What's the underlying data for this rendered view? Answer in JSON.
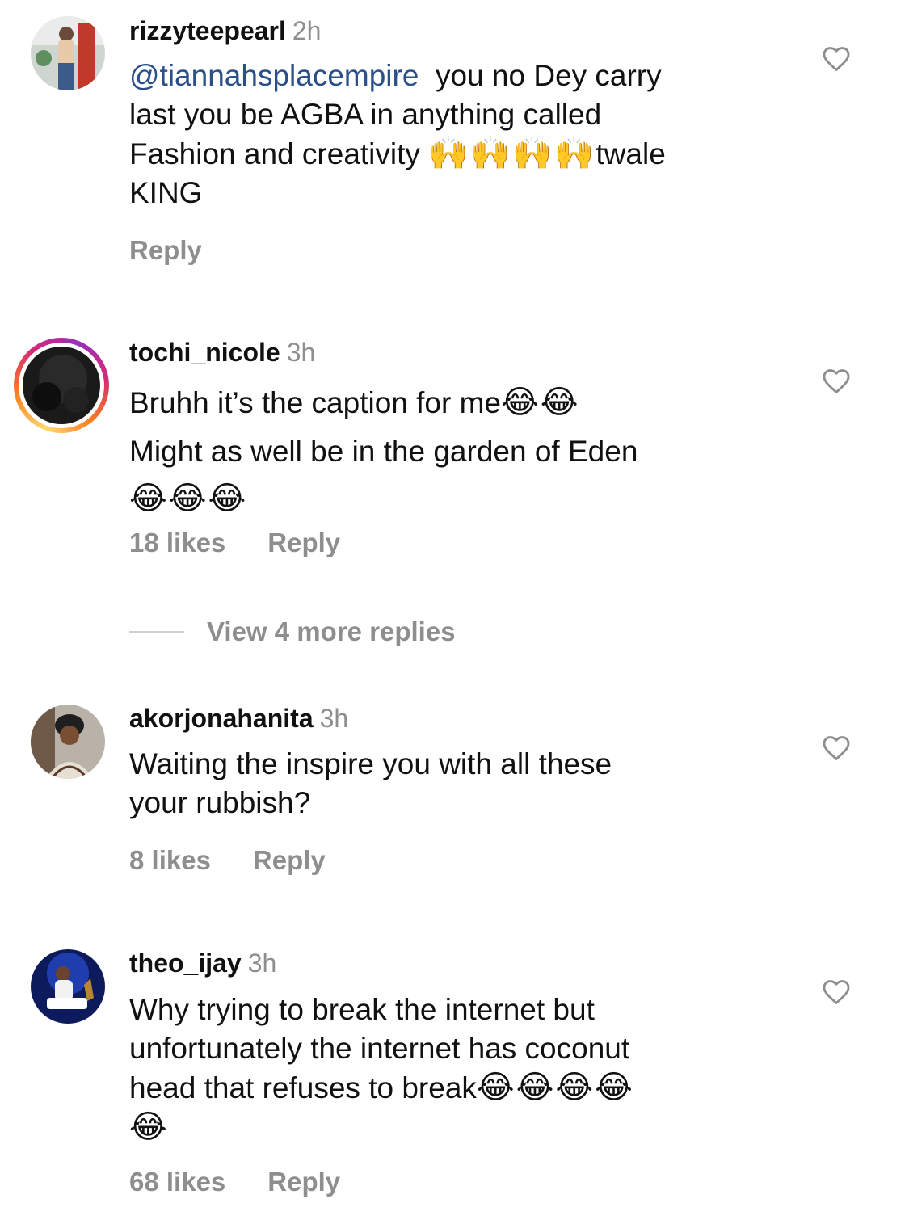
{
  "comments": [
    {
      "username": "rizzyteepearl",
      "time": "2h",
      "mention": "@tiannahsplacempire",
      "text_lines": [
        "  you no Dey carry",
        "last you be AGBA in anything called",
        "Fashion and creativity ",
        "KING"
      ],
      "emoji_inline": "🙌🙌🙌🙌",
      "text_after_emoji": "twale",
      "likes": "",
      "reply": "Reply"
    },
    {
      "username": "tochi_nicole",
      "time": "3h",
      "text_lines": [
        "Bruhh it’s the caption for me",
        "Might as well be in the garden of Eden"
      ],
      "emoji_line1": "😂😂",
      "emoji_line3": "😂😂😂",
      "likes": "18 likes",
      "reply": "Reply",
      "view_more": "View 4 more replies"
    },
    {
      "username": "akorjonahanita",
      "time": "3h",
      "text_lines": [
        "Waiting the inspire you with all these",
        "your rubbish?"
      ],
      "likes": "8 likes",
      "reply": "Reply"
    },
    {
      "username": "theo_ijay",
      "time": "3h",
      "text_lines": [
        "Why trying to break the internet but",
        "unfortunately the internet has coconut",
        "head that refuses to break"
      ],
      "emoji_line3": "😂😂😂😂",
      "emoji_line4": "😂",
      "likes": "68 likes",
      "reply": "Reply"
    }
  ],
  "icons": {
    "like": "heart-outline-icon"
  },
  "colors": {
    "mention": "#2b4f8a",
    "muted": "#8e8e8e",
    "text": "#111111"
  }
}
